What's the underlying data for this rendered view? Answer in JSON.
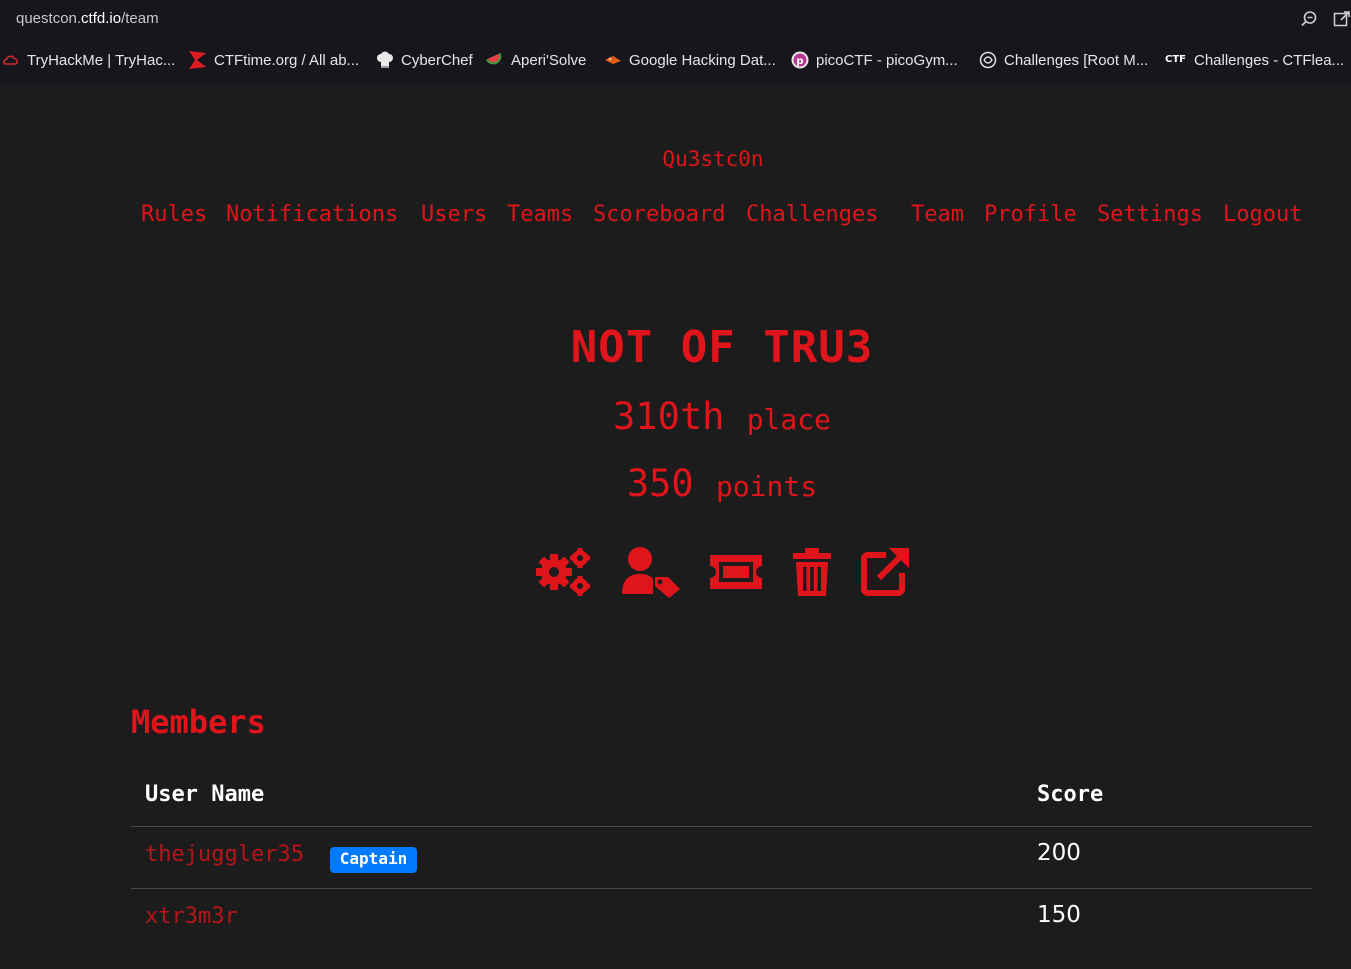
{
  "browser": {
    "url_prefix": "questcon.",
    "url_domain": "ctfd.io",
    "url_path": "/team",
    "bookmarks": [
      {
        "label": "TryHackMe | TryHac...",
        "icon": "tryhackme-icon"
      },
      {
        "label": "CTFtime.org / All ab...",
        "icon": "ctftime-icon"
      },
      {
        "label": "CyberChef",
        "icon": "chef-hat-icon"
      },
      {
        "label": "Aperi'Solve",
        "icon": "watermelon-icon"
      },
      {
        "label": "Google Hacking Dat...",
        "icon": "exploitdb-icon"
      },
      {
        "label": "picoCTF - picoGym...",
        "icon": "picoctf-icon"
      },
      {
        "label": "Challenges [Root M...",
        "icon": "rootme-icon"
      },
      {
        "label": "Challenges - CTFlea...",
        "icon": "ctf-icon"
      }
    ],
    "ctf_icon_text": "CTF"
  },
  "site": {
    "brand": "Qu3stc0n",
    "nav": [
      "Rules",
      "Notifications",
      "Users",
      "Teams",
      "Scoreboard",
      "Challenges",
      "Team",
      "Profile",
      "Settings",
      "Logout"
    ]
  },
  "team": {
    "name": "NOT OF TRU3",
    "place_value": "310th",
    "place_label": "place",
    "points_value": "350",
    "points_label": "points",
    "actions": [
      "settings-gears-icon",
      "user-tag-icon",
      "ticket-icon",
      "trash-icon",
      "external-link-icon"
    ]
  },
  "members": {
    "title": "Members",
    "headers": {
      "user": "User Name",
      "score": "Score"
    },
    "rows": [
      {
        "name": "thejuggler35",
        "badge": "Captain",
        "score": "200"
      },
      {
        "name": "xtr3m3r",
        "badge": "",
        "score": "150"
      }
    ]
  },
  "colors": {
    "accent": "#e0151b",
    "background": "#1c1c1c",
    "badge": "#007bff"
  }
}
